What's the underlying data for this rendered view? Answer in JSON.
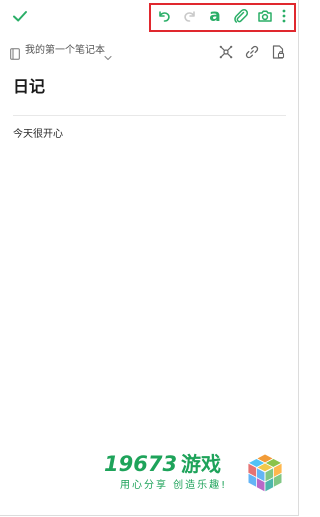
{
  "header": {
    "done_icon": "checkmark-icon",
    "toolbar_icons": [
      "undo-icon",
      "redo-icon",
      "text-format-icon",
      "attachment-icon",
      "camera-icon",
      "more-icon"
    ],
    "text_format_glyph": "a",
    "accent_color": "#2aae67",
    "highlight_color": "#e0282e"
  },
  "notebook": {
    "name": "我的第一个笔记本",
    "icons": [
      "mind-map-icon",
      "link-icon",
      "lock-icon"
    ]
  },
  "note": {
    "title": "日记",
    "body": "今天很开心"
  },
  "watermark": {
    "number": "19673",
    "name": "游戏",
    "slogan": "用心分享 创造乐趣!"
  }
}
